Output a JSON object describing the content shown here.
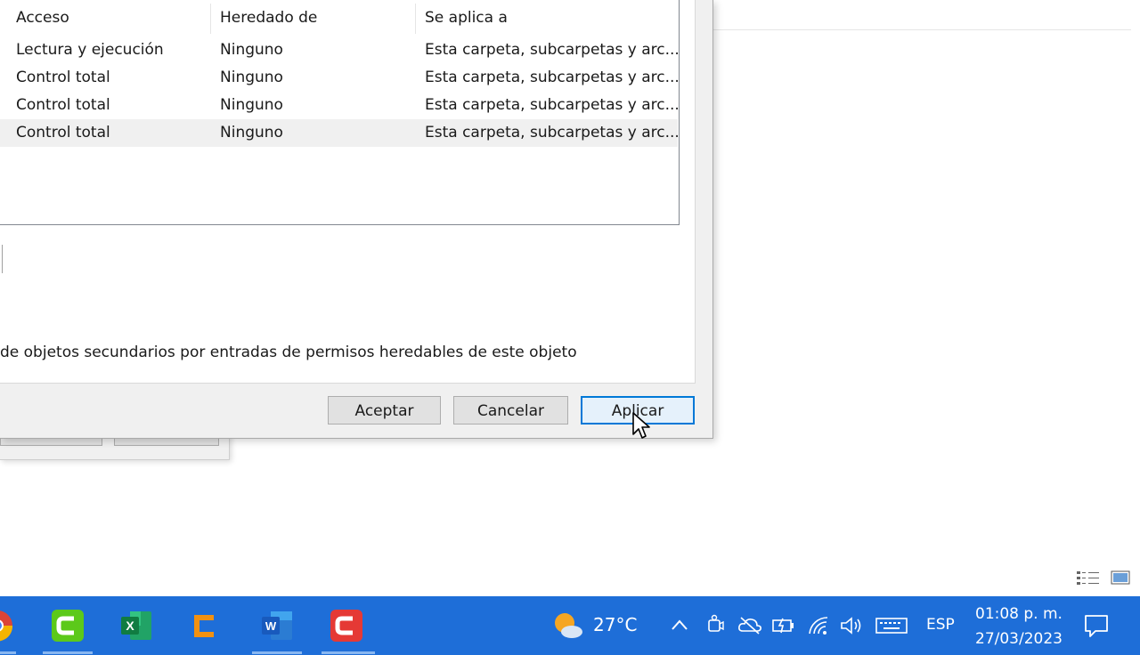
{
  "permissions_table": {
    "headers": [
      "Acceso",
      "Heredado de",
      "Se aplica a"
    ],
    "rows": [
      {
        "acceso": "Lectura y ejecución",
        "heredado": "Ninguno",
        "aplica": "Esta carpeta, subcarpetas y arc..."
      },
      {
        "acceso": "Control total",
        "heredado": "Ninguno",
        "aplica": "Esta carpeta, subcarpetas y arc..."
      },
      {
        "acceso": "Control total",
        "heredado": "Ninguno",
        "aplica": "Esta carpeta, subcarpetas y arc..."
      },
      {
        "acceso": "Control total",
        "heredado": "Ninguno",
        "aplica": "Esta carpeta, subcarpetas y arc..."
      }
    ]
  },
  "replace_option": "de objetos secundarios por entradas de permisos heredables de este objeto",
  "buttons": {
    "ok": "Aceptar",
    "cancel": "Cancelar",
    "apply": "Aplicar"
  },
  "taskbar": {
    "apps": [
      "chrome-icon",
      "camtasia-green-icon",
      "excel-icon",
      "orange-app-icon",
      "word-icon",
      "camtasia-red-icon"
    ],
    "weather_temp": "27°C",
    "language": "ESP",
    "time": "01:08 p. m.",
    "date": "27/03/2023"
  },
  "colors": {
    "taskbar": "#1e6ed8",
    "dialog": "#f0f0f0",
    "accent": "#0078d7"
  }
}
